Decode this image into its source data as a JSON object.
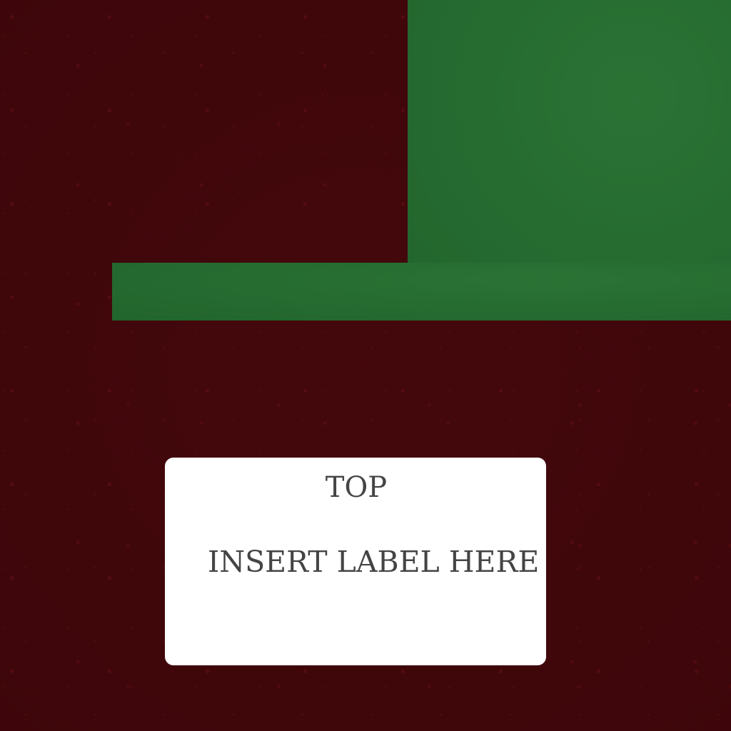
{
  "colors": {
    "background": "#42070b",
    "panel": "#246a2f",
    "label_card": "#ffffff",
    "label_text": "#444444"
  },
  "label": {
    "top_text": "TOP",
    "main_text": "INSERT LABEL HERE"
  }
}
